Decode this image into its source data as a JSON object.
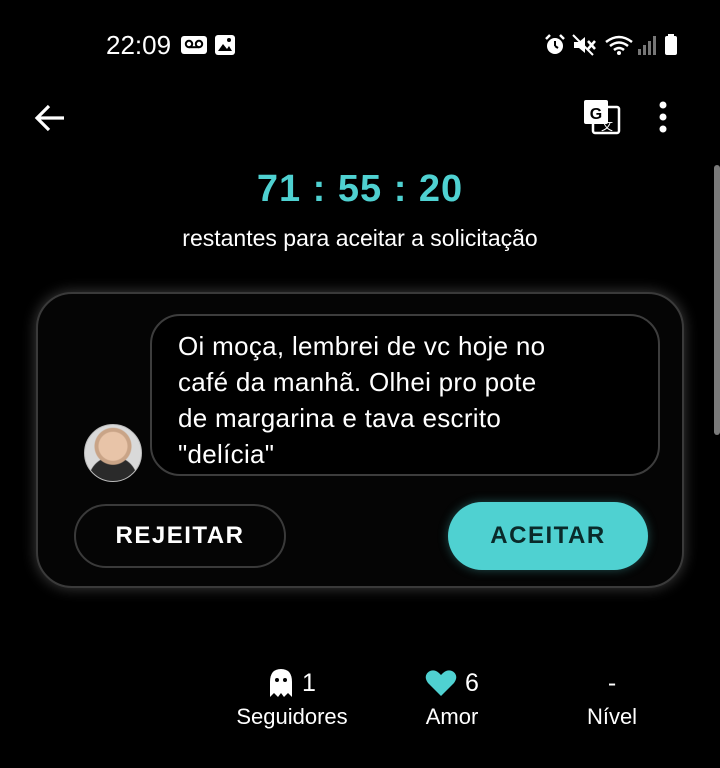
{
  "status_bar": {
    "time": "22:09",
    "icons": [
      "voicemail-icon",
      "image-icon",
      "alarm-icon",
      "mute-icon",
      "wifi-icon",
      "signal-icon",
      "battery-icon"
    ]
  },
  "app_bar": {
    "back_icon": "arrow-left-icon",
    "translate_icon": "translate-icon",
    "more_icon": "more-vertical-icon"
  },
  "countdown": {
    "time": "71 : 55 : 20",
    "label": "restantes para aceitar a solicitação"
  },
  "request": {
    "message": "Oi moça, lembrei de vc hoje no\ncafé da manhã. Olhei pro pote\nde margarina e tava escrito\n\"delícia\"",
    "reject_label": "REJEITAR",
    "accept_label": "ACEITAR"
  },
  "stats": [
    {
      "icon": "ghost-icon",
      "value": "1",
      "label": "Seguidores"
    },
    {
      "icon": "heart-icon",
      "value": "6",
      "label": "Amor"
    },
    {
      "icon": "",
      "value": "-",
      "label": "Nível"
    }
  ],
  "colors": {
    "accent": "#4fd1d1",
    "background": "#000000",
    "card_border": "#3a3a3a"
  }
}
